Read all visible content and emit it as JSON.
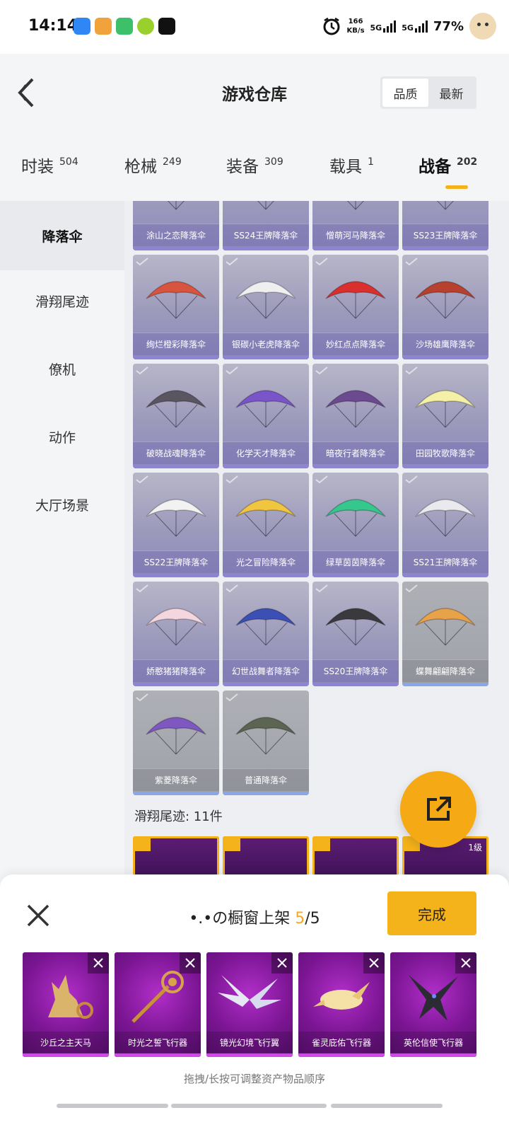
{
  "status_bar": {
    "time": "14:14",
    "speed_value": "166",
    "speed_unit": "KB/s",
    "net1": "5G",
    "net2": "5G",
    "battery": "77%"
  },
  "header": {
    "title": "游戏仓库",
    "sort_options": [
      "品质",
      "最新"
    ],
    "active_sort": "品质"
  },
  "tabs": [
    {
      "label": "时装",
      "count": "504"
    },
    {
      "label": "枪械",
      "count": "249"
    },
    {
      "label": "装备",
      "count": "309"
    },
    {
      "label": "载具",
      "count": "1"
    },
    {
      "label": "战备",
      "count": "202"
    }
  ],
  "sidebar": [
    "降落伞",
    "滑翔尾迹",
    "僚机",
    "动作",
    "大厅场景"
  ],
  "grid_items": [
    {
      "name": "涂山之恋降落伞",
      "color": "#c9c4d8"
    },
    {
      "name": "SS24王牌降落伞",
      "color": "#dcdce6"
    },
    {
      "name": "憎萌河马降落伞",
      "color": "#d9d9e2"
    },
    {
      "name": "SS23王牌降落伞",
      "color": "#e0a0a0"
    },
    {
      "name": "绚烂橙彩降落伞",
      "color": "#d9543f"
    },
    {
      "name": "银碳小老虎降落伞",
      "color": "#efefef"
    },
    {
      "name": "妙红点点降落伞",
      "color": "#d9302e"
    },
    {
      "name": "沙场雄鹰降落伞",
      "color": "#b8402f"
    },
    {
      "name": "破晓战魂降落伞",
      "color": "#5a5560"
    },
    {
      "name": "化学天才降落伞",
      "color": "#7a55c9"
    },
    {
      "name": "暗夜行者降落伞",
      "color": "#6b4a8f"
    },
    {
      "name": "田园牧歌降落伞",
      "color": "#f4f0a8"
    },
    {
      "name": "SS22王牌降落伞",
      "color": "#f2f2f2"
    },
    {
      "name": "光之冒险降落伞",
      "color": "#f0c540"
    },
    {
      "name": "绿草茵茵降落伞",
      "color": "#36c78c"
    },
    {
      "name": "SS21王牌降落伞",
      "color": "#e9e9ee"
    },
    {
      "name": "娇憨猪猪降落伞",
      "color": "#f4d6de"
    },
    {
      "name": "幻世战舞者降落伞",
      "color": "#3b4fb5"
    },
    {
      "name": "SS20王牌降落伞",
      "color": "#3a3a3e"
    },
    {
      "name": "蝶舞翩翩降落伞",
      "color": "#e8a24a"
    },
    {
      "name": "紫菱降落伞",
      "color": "#7e58c0"
    },
    {
      "name": "普通降落伞",
      "color": "#5c6452"
    }
  ],
  "section_title": "滑翔尾迹: 11件",
  "level_badge": "1级",
  "panel": {
    "shelf_prefix": "•.•の橱窗上架",
    "shelf_count": "5",
    "shelf_total": "/5",
    "done_label": "完成",
    "items": [
      {
        "name": "沙丘之主天马"
      },
      {
        "name": "时光之誓飞行器"
      },
      {
        "name": "镜光幻境飞行翼"
      },
      {
        "name": "雀灵庇佑飞行器"
      },
      {
        "name": "英伦信使飞行器"
      }
    ],
    "hint": "拖拽/长按可调整资产物品顺序"
  }
}
